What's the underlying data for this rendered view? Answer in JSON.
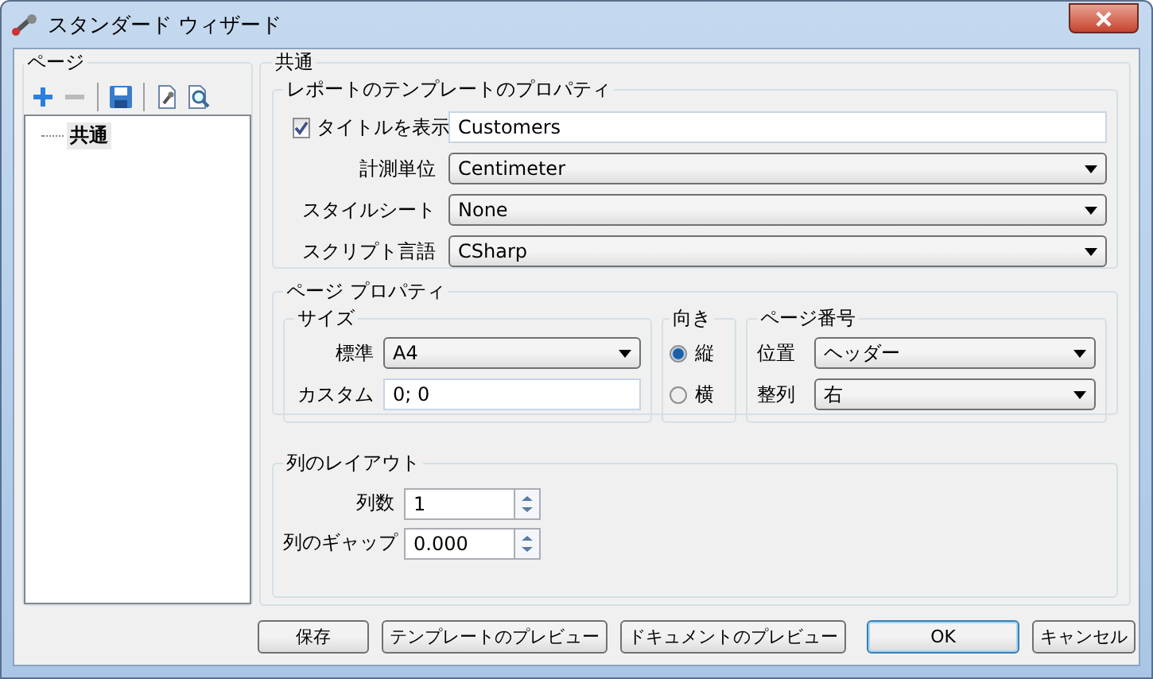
{
  "window": {
    "title": "スタンダード ウィザード"
  },
  "pages_panel": {
    "title": "ページ",
    "toolbar": [
      {
        "kind": "add",
        "disabled": false
      },
      {
        "kind": "remove",
        "disabled": true
      },
      {
        "kind": "save",
        "disabled": false
      },
      {
        "kind": "design",
        "disabled": false
      },
      {
        "kind": "preview",
        "disabled": false
      }
    ],
    "tree": [
      {
        "label": "共通",
        "selected": true
      }
    ]
  },
  "common": {
    "title": "共通",
    "template_properties": {
      "title": "レポートのテンプレートのプロパティ",
      "show_title": {
        "label": "タイトルを表示",
        "checked": true,
        "value": "Customers"
      },
      "fields": [
        {
          "label": "計測単位",
          "value": "Centimeter"
        },
        {
          "label": "スタイルシート",
          "value": "None"
        },
        {
          "label": "スクリプト言語",
          "value": "CSharp"
        }
      ]
    },
    "page_properties": {
      "title": "ページ プロパティ",
      "size": {
        "title": "サイズ",
        "standard_label": "標準",
        "standard": "A4",
        "custom_label": "カスタム",
        "custom": "0; 0"
      },
      "orientation": {
        "title": "向き",
        "options": [
          {
            "label": "縦",
            "selected": true
          },
          {
            "label": "横",
            "selected": false
          }
        ]
      },
      "page_number": {
        "title": "ページ番号",
        "position_label": "位置",
        "position": "ヘッダー",
        "align_label": "整列",
        "align": "右"
      }
    },
    "column_layout": {
      "title": "列のレイアウト",
      "count_label": "列数",
      "count": "1",
      "gap_label": "列のギャップ",
      "gap": "0.000"
    }
  },
  "buttons": [
    {
      "label": "保存",
      "default": false
    },
    {
      "label": "テンプレートのプレビュー",
      "default": false
    },
    {
      "label": "ドキュメントのプレビュー",
      "default": false
    },
    {
      "label": "OK",
      "default": true
    },
    {
      "label": "キャンセル",
      "default": false
    }
  ]
}
